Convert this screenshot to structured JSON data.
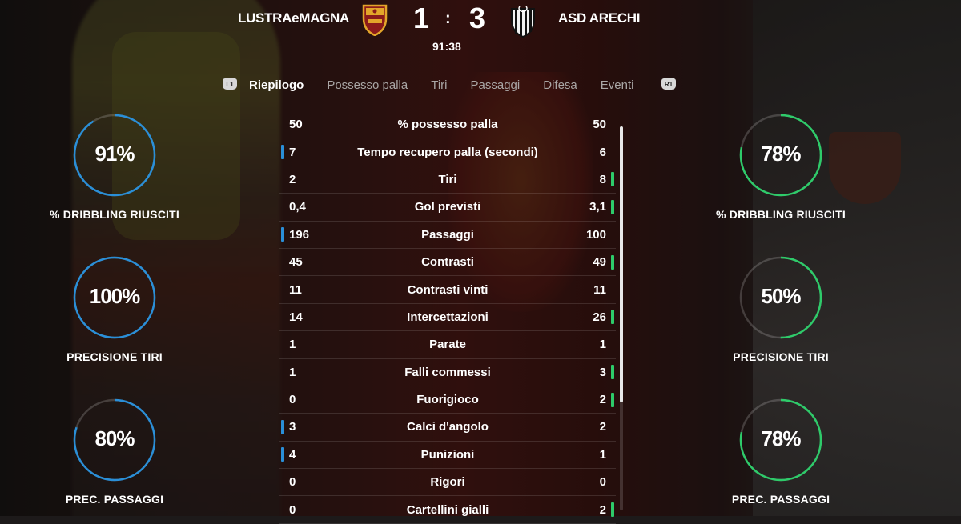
{
  "match": {
    "home_team": "LUSTRAeMAGNA",
    "away_team": "ASD ARECHI",
    "home_score": "1",
    "away_score": "3",
    "separator": ":",
    "clock": "91:38"
  },
  "tabs": {
    "left_shoulder": "L1",
    "right_shoulder": "R1",
    "items": [
      "Riepilogo",
      "Possesso palla",
      "Tiri",
      "Passaggi",
      "Difesa",
      "Eventi"
    ],
    "active": "Riepilogo"
  },
  "colors": {
    "home_accent": "#2a8fd8",
    "away_accent": "#2ecb6a"
  },
  "home_rings": [
    {
      "value": "91%",
      "fraction": 0.91,
      "label": "% DRIBBLING RIUSCITI"
    },
    {
      "value": "100%",
      "fraction": 1.0,
      "label": "PRECISIONE TIRI"
    },
    {
      "value": "80%",
      "fraction": 0.8,
      "label": "PREC. PASSAGGI"
    }
  ],
  "away_rings": [
    {
      "value": "78%",
      "fraction": 0.78,
      "label": "% DRIBBLING RIUSCITI"
    },
    {
      "value": "50%",
      "fraction": 0.5,
      "label": "PRECISIONE TIRI"
    },
    {
      "value": "78%",
      "fraction": 0.78,
      "label": "PREC. PASSAGGI"
    }
  ],
  "stats": [
    {
      "home": "50",
      "name": "% possesso palla",
      "away": "50",
      "leader": ""
    },
    {
      "home": "7",
      "name": "Tempo recupero palla (secondi)",
      "away": "6",
      "leader": "home"
    },
    {
      "home": "2",
      "name": "Tiri",
      "away": "8",
      "leader": "away"
    },
    {
      "home": "0,4",
      "name": "Gol previsti",
      "away": "3,1",
      "leader": "away"
    },
    {
      "home": "196",
      "name": "Passaggi",
      "away": "100",
      "leader": "home"
    },
    {
      "home": "45",
      "name": "Contrasti",
      "away": "49",
      "leader": "away"
    },
    {
      "home": "11",
      "name": "Contrasti vinti",
      "away": "11",
      "leader": ""
    },
    {
      "home": "14",
      "name": "Intercettazioni",
      "away": "26",
      "leader": "away"
    },
    {
      "home": "1",
      "name": "Parate",
      "away": "1",
      "leader": ""
    },
    {
      "home": "1",
      "name": "Falli commessi",
      "away": "3",
      "leader": "away"
    },
    {
      "home": "0",
      "name": "Fuorigioco",
      "away": "2",
      "leader": "away"
    },
    {
      "home": "3",
      "name": "Calci d'angolo",
      "away": "2",
      "leader": "home"
    },
    {
      "home": "4",
      "name": "Punizioni",
      "away": "1",
      "leader": "home"
    },
    {
      "home": "0",
      "name": "Rigori",
      "away": "0",
      "leader": ""
    },
    {
      "home": "0",
      "name": "Cartellini gialli",
      "away": "2",
      "leader": "away"
    }
  ]
}
